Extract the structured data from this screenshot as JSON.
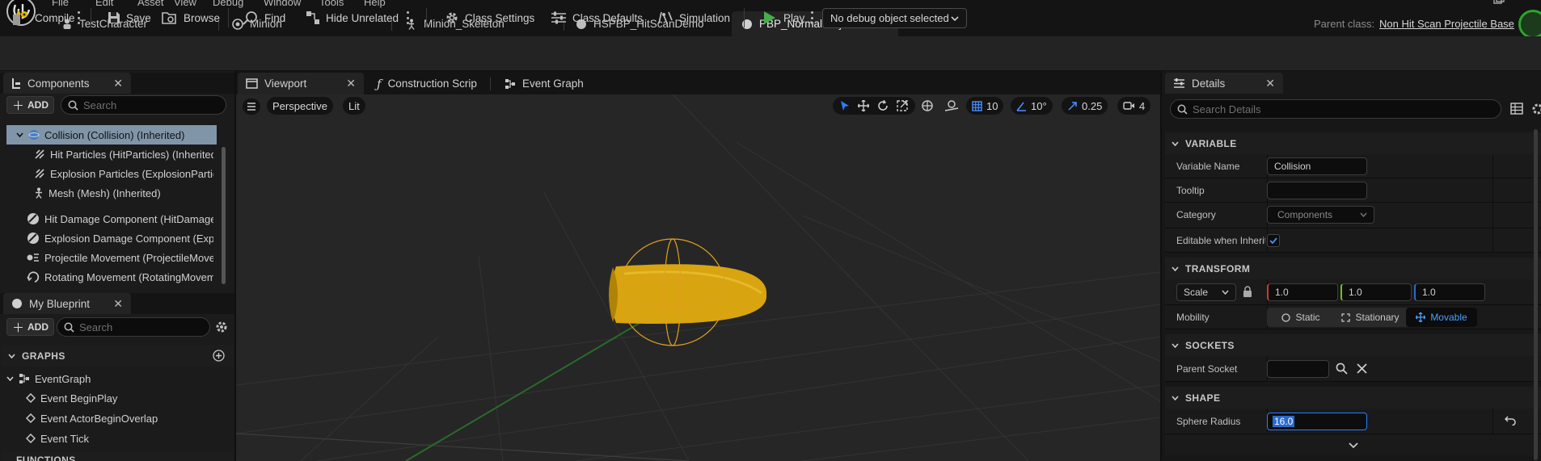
{
  "menu": [
    "File",
    "Edit",
    "Asset",
    "View",
    "Debug",
    "Window",
    "Tools",
    "Help"
  ],
  "doc_tabs": [
    {
      "label": "TestCharacter",
      "icon": "character-icon"
    },
    {
      "label": "Minion",
      "icon": "blueprint-icon"
    },
    {
      "label": "Minion_Skeleton",
      "icon": "skeleton-icon"
    },
    {
      "label": "HSPBP_HitScanDemo",
      "icon": "blueprint-icon"
    },
    {
      "label": "PBP_NormalProjectile*",
      "icon": "blueprint-icon"
    }
  ],
  "parent_class": {
    "label": "Parent class:",
    "value": "Non Hit Scan Projectile Base"
  },
  "toolbar": {
    "compile": "Compile",
    "save": "Save",
    "browse": "Browse",
    "find": "Find",
    "hide_unrelated": "Hide Unrelated",
    "class_settings": "Class Settings",
    "class_defaults": "Class Defaults",
    "simulation": "Simulation",
    "play": "Play",
    "debug_object": "No debug object selected"
  },
  "components_panel": {
    "title": "Components",
    "add": "ADD",
    "search_placeholder": "Search",
    "items": [
      "Collision (Collision) (Inherited)",
      "Hit Particles (HitParticles) (Inherited)",
      "Explosion Particles (ExplosionParticles)",
      "Mesh (Mesh) (Inherited)",
      "Hit Damage Component (HitDamageComponent)",
      "Explosion Damage Component (ExplosionDamageComponent)",
      "Projectile Movement (ProjectileMovement)",
      "Rotating Movement (RotatingMovement)"
    ]
  },
  "my_blueprint_panel": {
    "title": "My Blueprint",
    "add": "ADD",
    "search_placeholder": "Search",
    "graphs_header": "GRAPHS",
    "event_graph": "EventGraph",
    "events": [
      "Event BeginPlay",
      "Event ActorBeginOverlap",
      "Event Tick"
    ],
    "functions_header": "FUNCTIONS"
  },
  "editor_tabs": [
    "Viewport",
    "Construction Script",
    "Event Graph"
  ],
  "viewport": {
    "perspective": "Perspective",
    "lit": "Lit",
    "grid_snap": "10",
    "rotation_snap": "10°",
    "scale_snap": "0.25",
    "camera_speed": "4"
  },
  "details": {
    "title": "Details",
    "search_placeholder": "Search Details",
    "variable_header": "VARIABLE",
    "variable_name_label": "Variable Name",
    "variable_name_value": "Collision",
    "tooltip_label": "Tooltip",
    "tooltip_value": "",
    "category_label": "Category",
    "category_value": "Components",
    "editable_label": "Editable when Inherited",
    "editable_checked": true,
    "transform_header": "TRANSFORM",
    "scale_mode": "Scale",
    "scale_x": "1.0",
    "scale_y": "1.0",
    "scale_z": "1.0",
    "mobility_label": "Mobility",
    "mobility_options": [
      "Static",
      "Stationary",
      "Movable"
    ],
    "mobility_selected": "Movable",
    "sockets_header": "SOCKETS",
    "parent_socket_label": "Parent Socket",
    "parent_socket_value": "",
    "shape_header": "SHAPE",
    "sphere_radius_label": "Sphere Radius",
    "sphere_radius_value": "16.0"
  },
  "colors": {
    "accent_blue": "#2a7fff",
    "play_green": "#43b049",
    "selection": "#8095a8",
    "mesh_gold": "#d8a410"
  }
}
